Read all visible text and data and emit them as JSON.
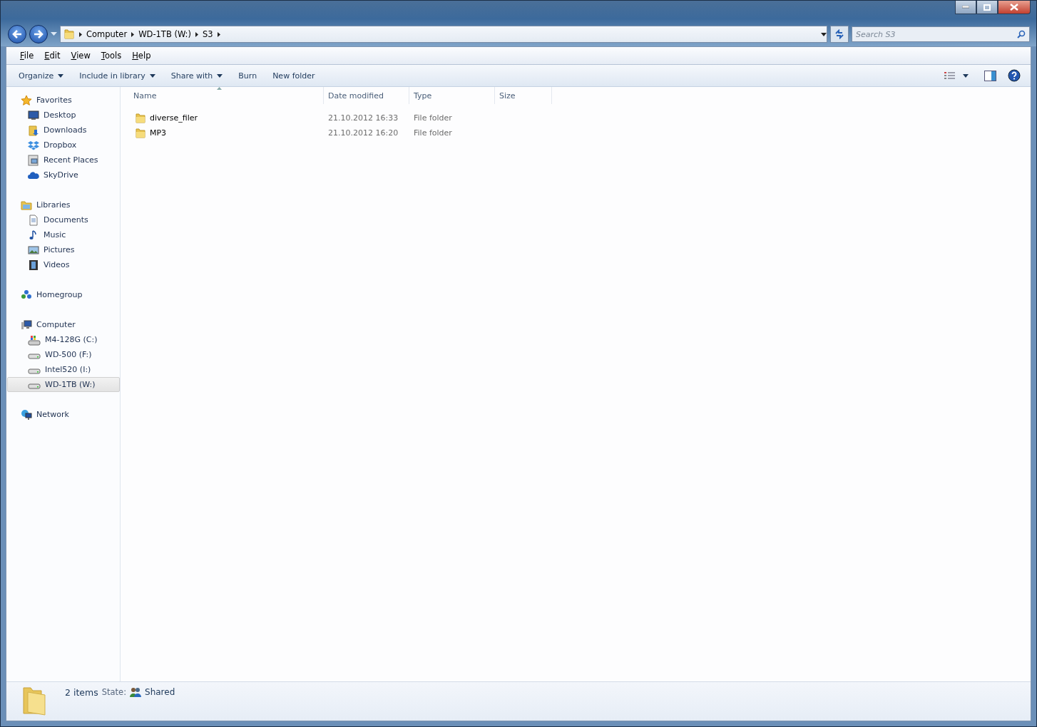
{
  "address_bar": {
    "segments": [
      "Computer",
      "WD-1TB (W:)",
      "S3"
    ]
  },
  "search": {
    "placeholder": "Search S3"
  },
  "menu": [
    "File",
    "Edit",
    "View",
    "Tools",
    "Help"
  ],
  "toolbar": [
    {
      "label": "Organize",
      "dropdown": true
    },
    {
      "label": "Include in library",
      "dropdown": true
    },
    {
      "label": "Share with",
      "dropdown": true
    },
    {
      "label": "Burn",
      "dropdown": false
    },
    {
      "label": "New folder",
      "dropdown": false
    }
  ],
  "nav": [
    {
      "label": "Favorites",
      "selected": false,
      "children": [
        {
          "label": "Desktop",
          "selected": false
        },
        {
          "label": "Downloads",
          "selected": false
        },
        {
          "label": "Dropbox",
          "selected": false
        },
        {
          "label": "Recent Places",
          "selected": false
        },
        {
          "label": "SkyDrive",
          "selected": false
        }
      ]
    },
    {
      "label": "Libraries",
      "selected": false,
      "children": [
        {
          "label": "Documents",
          "selected": false
        },
        {
          "label": "Music",
          "selected": false
        },
        {
          "label": "Pictures",
          "selected": false
        },
        {
          "label": "Videos",
          "selected": false
        }
      ]
    },
    {
      "label": "Homegroup",
      "selected": false
    },
    {
      "label": "Computer",
      "selected": false,
      "children": [
        {
          "label": "M4-128G (C:)",
          "selected": false
        },
        {
          "label": "WD-500 (F:)",
          "selected": false
        },
        {
          "label": "Intel520 (I:)",
          "selected": false
        },
        {
          "label": "WD-1TB (W:)",
          "selected": true
        }
      ]
    },
    {
      "label": "Network",
      "selected": false
    }
  ],
  "columns": [
    {
      "label": "Name",
      "sorted": true
    },
    {
      "label": "Date modified",
      "sorted": false
    },
    {
      "label": "Type",
      "sorted": false
    },
    {
      "label": "Size",
      "sorted": false
    }
  ],
  "rows": [
    {
      "name": "diverse_filer",
      "date": "21.10.2012 16:33",
      "type": "File folder"
    },
    {
      "name": "MP3",
      "date": "21.10.2012 16:20",
      "type": "File folder"
    }
  ],
  "status_bar": {
    "count": "2 items",
    "state_label": "State:",
    "state_value": "Shared"
  }
}
